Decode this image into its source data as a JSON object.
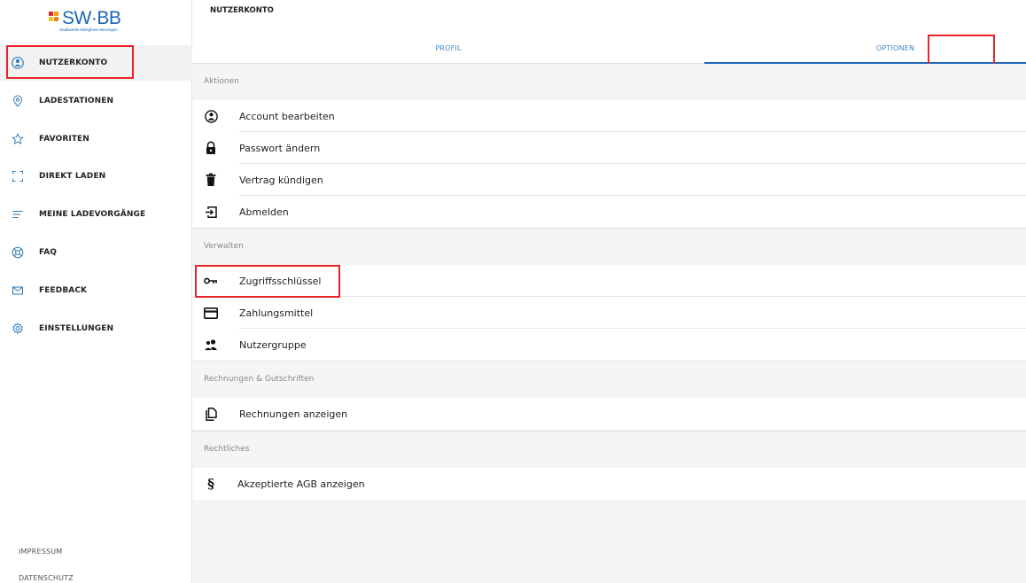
{
  "logo": {
    "wordmark": "SW·BB",
    "subtitle": "Stadtwerke Bietigheim-Bissingen",
    "square_colors": [
      "#e8232a",
      "#f39c12",
      "#f1c40f",
      "#e67e22"
    ],
    "brand_color": "#1a66b3"
  },
  "sidebar": {
    "items": [
      {
        "label": "NUTZERKONTO",
        "icon": "account-icon",
        "active": true
      },
      {
        "label": "LADESTATIONEN",
        "icon": "location-pin-icon",
        "active": false
      },
      {
        "label": "FAVORITEN",
        "icon": "star-icon",
        "active": false
      },
      {
        "label": "DIREKT LADEN",
        "icon": "scan-frame-icon",
        "active": false
      },
      {
        "label": "MEINE LADEVORGÄNGE",
        "icon": "list-lines-icon",
        "active": false
      },
      {
        "label": "FAQ",
        "icon": "help-ring-icon",
        "active": false
      },
      {
        "label": "FEEDBACK",
        "icon": "envelope-icon",
        "active": false
      },
      {
        "label": "EINSTELLUNGEN",
        "icon": "gear-icon",
        "active": false
      }
    ],
    "footer": {
      "impressum": "IMPRESSUM",
      "datenschutz": "DATENSCHUTZ"
    }
  },
  "main": {
    "title": "NUTZERKONTO",
    "tabs": [
      {
        "label": "PROFIL",
        "active": false
      },
      {
        "label": "OPTIONEN",
        "active": true
      }
    ],
    "sections": [
      {
        "header": "Aktionen",
        "items": [
          {
            "label": "Account bearbeiten",
            "icon": "account-icon"
          },
          {
            "label": "Passwort ändern",
            "icon": "lock-icon"
          },
          {
            "label": "Vertrag kündigen",
            "icon": "trash-icon"
          },
          {
            "label": "Abmelden",
            "icon": "logout-icon"
          }
        ]
      },
      {
        "header": "Verwalten",
        "items": [
          {
            "label": "Zugriffsschlüssel",
            "icon": "key-icon"
          },
          {
            "label": "Zahlungsmittel",
            "icon": "credit-card-icon"
          },
          {
            "label": "Nutzergruppe",
            "icon": "user-group-icon"
          }
        ]
      },
      {
        "header": "Rechnungen & Gutschriften",
        "items": [
          {
            "label": "Rechnungen anzeigen",
            "icon": "document-icon"
          }
        ]
      },
      {
        "header": "Rechtliches",
        "items": [
          {
            "label": "Akzeptierte AGB anzeigen",
            "icon": "paragraph-icon"
          }
        ]
      }
    ]
  },
  "colors": {
    "accent": "#1a66b3",
    "tab_text": "#3a87c8",
    "highlight": "#e8232a"
  }
}
